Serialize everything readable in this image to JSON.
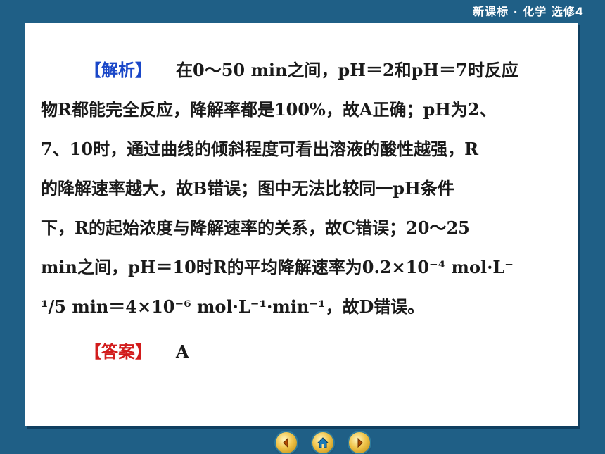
{
  "header": {
    "title": "新课标 · 化学  选修4"
  },
  "analysis": {
    "tag": "【解析】",
    "lines": [
      "在0～50  min之间，pH＝2和pH＝7时反应",
      "物R都能完全反应，降解率都是100%，故A正确；pH为2、",
      "7、10时，通过曲线的倾斜程度可看出溶液的酸性越强，R",
      "的降解速率越大，故B错误；图中无法比较同一pH条件",
      "下，R的起始浓度与降解速率的关系，故C错误；20～25",
      "min之间，pH＝10时R的平均降解速率为0.2×10⁻⁴   mol·L⁻",
      "¹/5 min＝4×10⁻⁶ mol·L⁻¹·min⁻¹，故D错误。"
    ]
  },
  "answer": {
    "tag": "【答案】",
    "value": "A"
  },
  "nav": {
    "icons": [
      "prev-icon",
      "home-icon",
      "next-icon"
    ]
  }
}
